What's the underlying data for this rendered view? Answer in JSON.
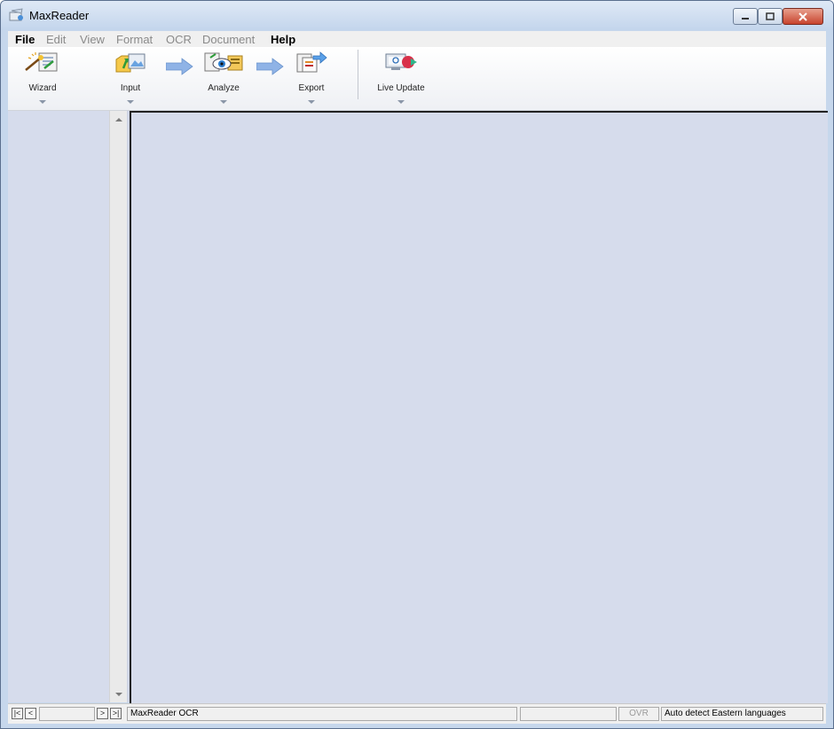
{
  "window": {
    "title": "MaxReader"
  },
  "menu": [
    {
      "label": "File",
      "enabled": true
    },
    {
      "label": "Edit",
      "enabled": false
    },
    {
      "label": "View",
      "enabled": false
    },
    {
      "label": "Format",
      "enabled": false
    },
    {
      "label": "OCR",
      "enabled": false
    },
    {
      "label": "Document",
      "enabled": false
    },
    {
      "label": "Help",
      "enabled": true
    }
  ],
  "toolbar": {
    "wizard": "Wizard",
    "input": "Input",
    "analyze": "Analyze",
    "export": "Export",
    "live_update": "Live Update"
  },
  "status": {
    "page_field": "",
    "message": "MaxReader OCR",
    "blank": "",
    "mode": "OVR",
    "language": "Auto detect Eastern languages"
  },
  "colors": {
    "workspace": "#d6dcec",
    "title_gradient_top": "#dfe9f6",
    "close_button": "#c8442e"
  }
}
